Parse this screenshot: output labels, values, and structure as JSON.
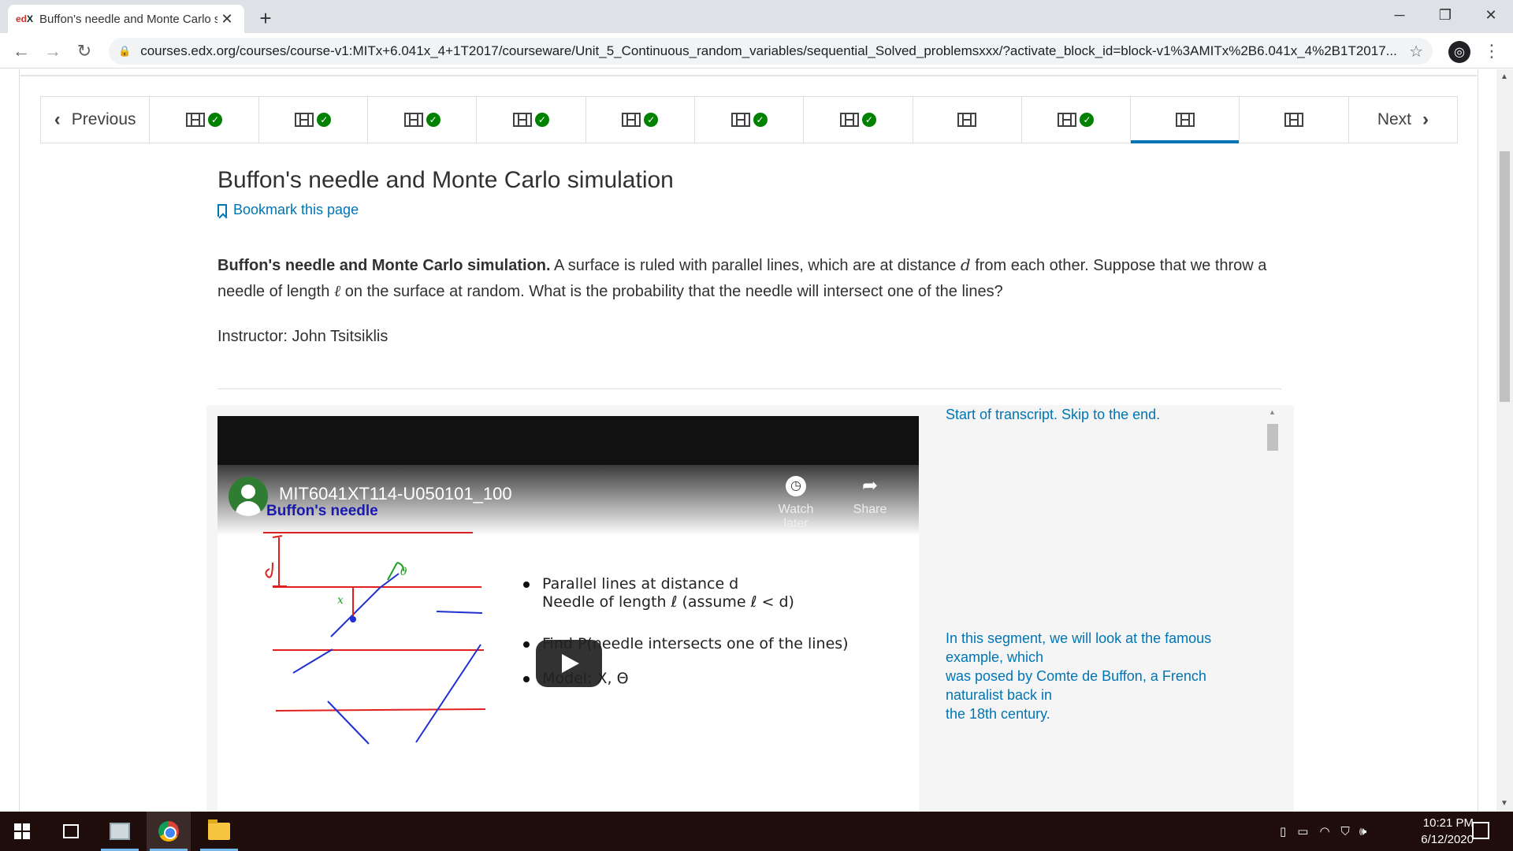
{
  "browser": {
    "tab_title": "Buffon's needle and Monte Carlo simulation | Unit 5",
    "tab_favicon_prefix": "ed",
    "tab_favicon_x": "X",
    "url": "courses.edx.org/courses/course-v1:MITx+6.041x_4+1T2017/courseware/Unit_5_Continuous_random_variables/sequential_Solved_problemsxxx/?activate_block_id=block-v1%3AMITx%2B6.041x_4%2B1T2017..."
  },
  "seqnav": {
    "previous_label": "Previous",
    "next_label": "Next",
    "items": [
      {
        "kind": "video",
        "completed": true
      },
      {
        "kind": "video",
        "completed": true
      },
      {
        "kind": "video",
        "completed": true
      },
      {
        "kind": "video",
        "completed": true
      },
      {
        "kind": "video",
        "completed": true
      },
      {
        "kind": "video",
        "completed": true
      },
      {
        "kind": "video",
        "completed": true
      },
      {
        "kind": "video",
        "completed": false
      },
      {
        "kind": "video",
        "completed": true
      },
      {
        "kind": "video",
        "completed": false,
        "active": true
      },
      {
        "kind": "video",
        "completed": false
      }
    ]
  },
  "unit": {
    "title": "Buffon's needle and Monte Carlo simulation",
    "bookmark_label": "Bookmark this page",
    "desc_bold": "Buffon's needle and Monte Carlo simulation.",
    "desc_part1": " A surface is ruled with parallel lines, which are at distance ",
    "desc_var_d": "d",
    "desc_part2": " from each other. Suppose that we throw a needle of length ",
    "desc_var_l": "ℓ",
    "desc_part3": " on the surface at random. What is the probability that the needle will intersect one of the lines?",
    "instructor": "Instructor: John Tsitsiklis"
  },
  "video": {
    "yt_title": "MIT6041XT114-U050101_100",
    "slide_heading": "Buffon's needle",
    "watch_later_label": "Watch later",
    "share_label": "Share",
    "bullet1_line1": "Parallel lines at distance d",
    "bullet1_line2": "Needle of length ℓ (assume ℓ < d)",
    "bullet2": "Find P(needle intersects one of the lines)",
    "bullet3": "Model: X, Θ"
  },
  "transcript": {
    "skip_label": "Start of transcript. Skip to the end.",
    "lines": [
      "In this segment, we will look at the famous example, which",
      "was posed by Comte de Buffon, a French naturalist back in",
      "the 18th century."
    ]
  },
  "taskbar": {
    "time": "10:21 PM",
    "date": "6/12/2020"
  },
  "colors": {
    "accent": "#0075b4",
    "check": "#008100",
    "taskbar": "#1f0d0b"
  }
}
